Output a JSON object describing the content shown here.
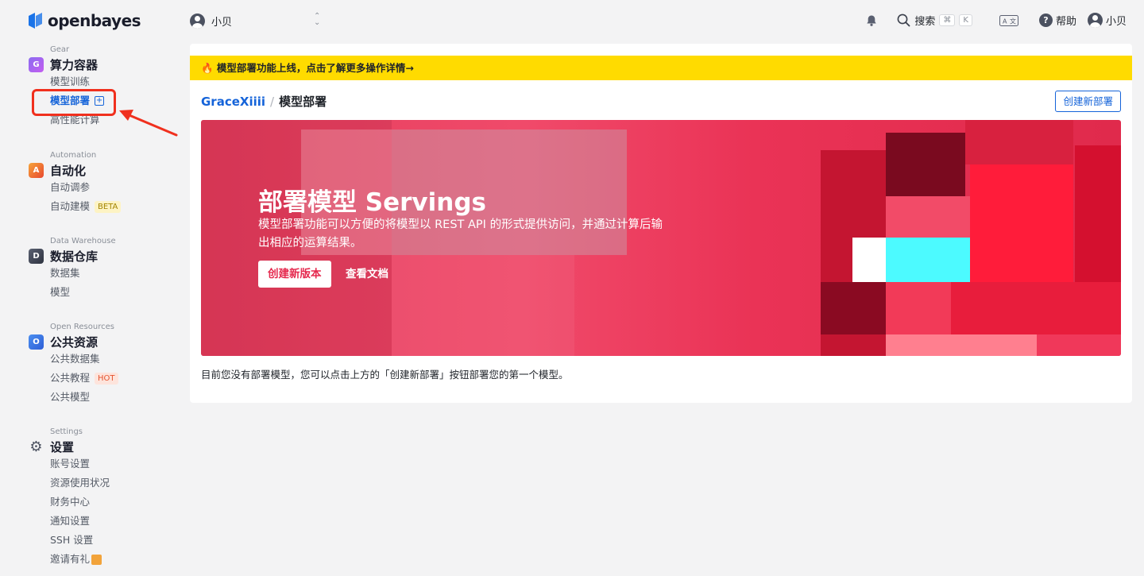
{
  "app": {
    "logo_text": "openbayes"
  },
  "sidebar": {
    "groups": [
      {
        "en": "Gear",
        "label": "算力容器",
        "items": [
          {
            "label": "模型训练"
          },
          {
            "label": "模型部署"
          },
          {
            "label": "高性能计算"
          }
        ]
      },
      {
        "en": "Automation",
        "label": "自动化",
        "items": [
          {
            "label": "自动调参"
          },
          {
            "label": "自动建模",
            "badge": "BETA"
          }
        ]
      },
      {
        "en": "Data Warehouse",
        "label": "数据仓库",
        "items": [
          {
            "label": "数据集"
          },
          {
            "label": "模型"
          }
        ]
      },
      {
        "en": "Open Resources",
        "label": "公共资源",
        "items": [
          {
            "label": "公共数据集"
          },
          {
            "label": "公共教程",
            "badge": "HOT"
          },
          {
            "label": "公共模型"
          }
        ]
      },
      {
        "en": "Settings",
        "label": "设置",
        "items": [
          {
            "label": "账号设置"
          },
          {
            "label": "资源使用状况"
          },
          {
            "label": "财务中心"
          },
          {
            "label": "通知设置"
          },
          {
            "label": "SSH 设置"
          },
          {
            "label": "邀请有礼"
          }
        ]
      }
    ]
  },
  "header": {
    "org_name": "小贝",
    "search_label": "搜索",
    "search_kbd_1": "⌘",
    "search_kbd_2": "K",
    "help_label": "帮助",
    "user_name": "小贝"
  },
  "main": {
    "notice": "🔥 模型部署功能上线，点击了解更多操作详情→",
    "breadcrumb": {
      "owner": "GraceXiiii",
      "separator": "/",
      "current": "模型部署"
    },
    "create_button": "创建新部署",
    "banner": {
      "title": "部署模型 Servings",
      "desc": "模型部署功能可以方便的将模型以 REST API 的形式提供访问，并通过计算后输出相应的运算结果。",
      "primary_button": "创建新版本",
      "doc_link": "查看文档"
    },
    "empty_hint": "目前您没有部署模型，您可以点击上方的「创建新部署」按钮部署您的第一个模型。"
  },
  "colors": {
    "accent": "#1463d9",
    "notice_bg": "#ffdb00",
    "banner_red": "#e43d5c",
    "highlight": "#f0301e"
  }
}
